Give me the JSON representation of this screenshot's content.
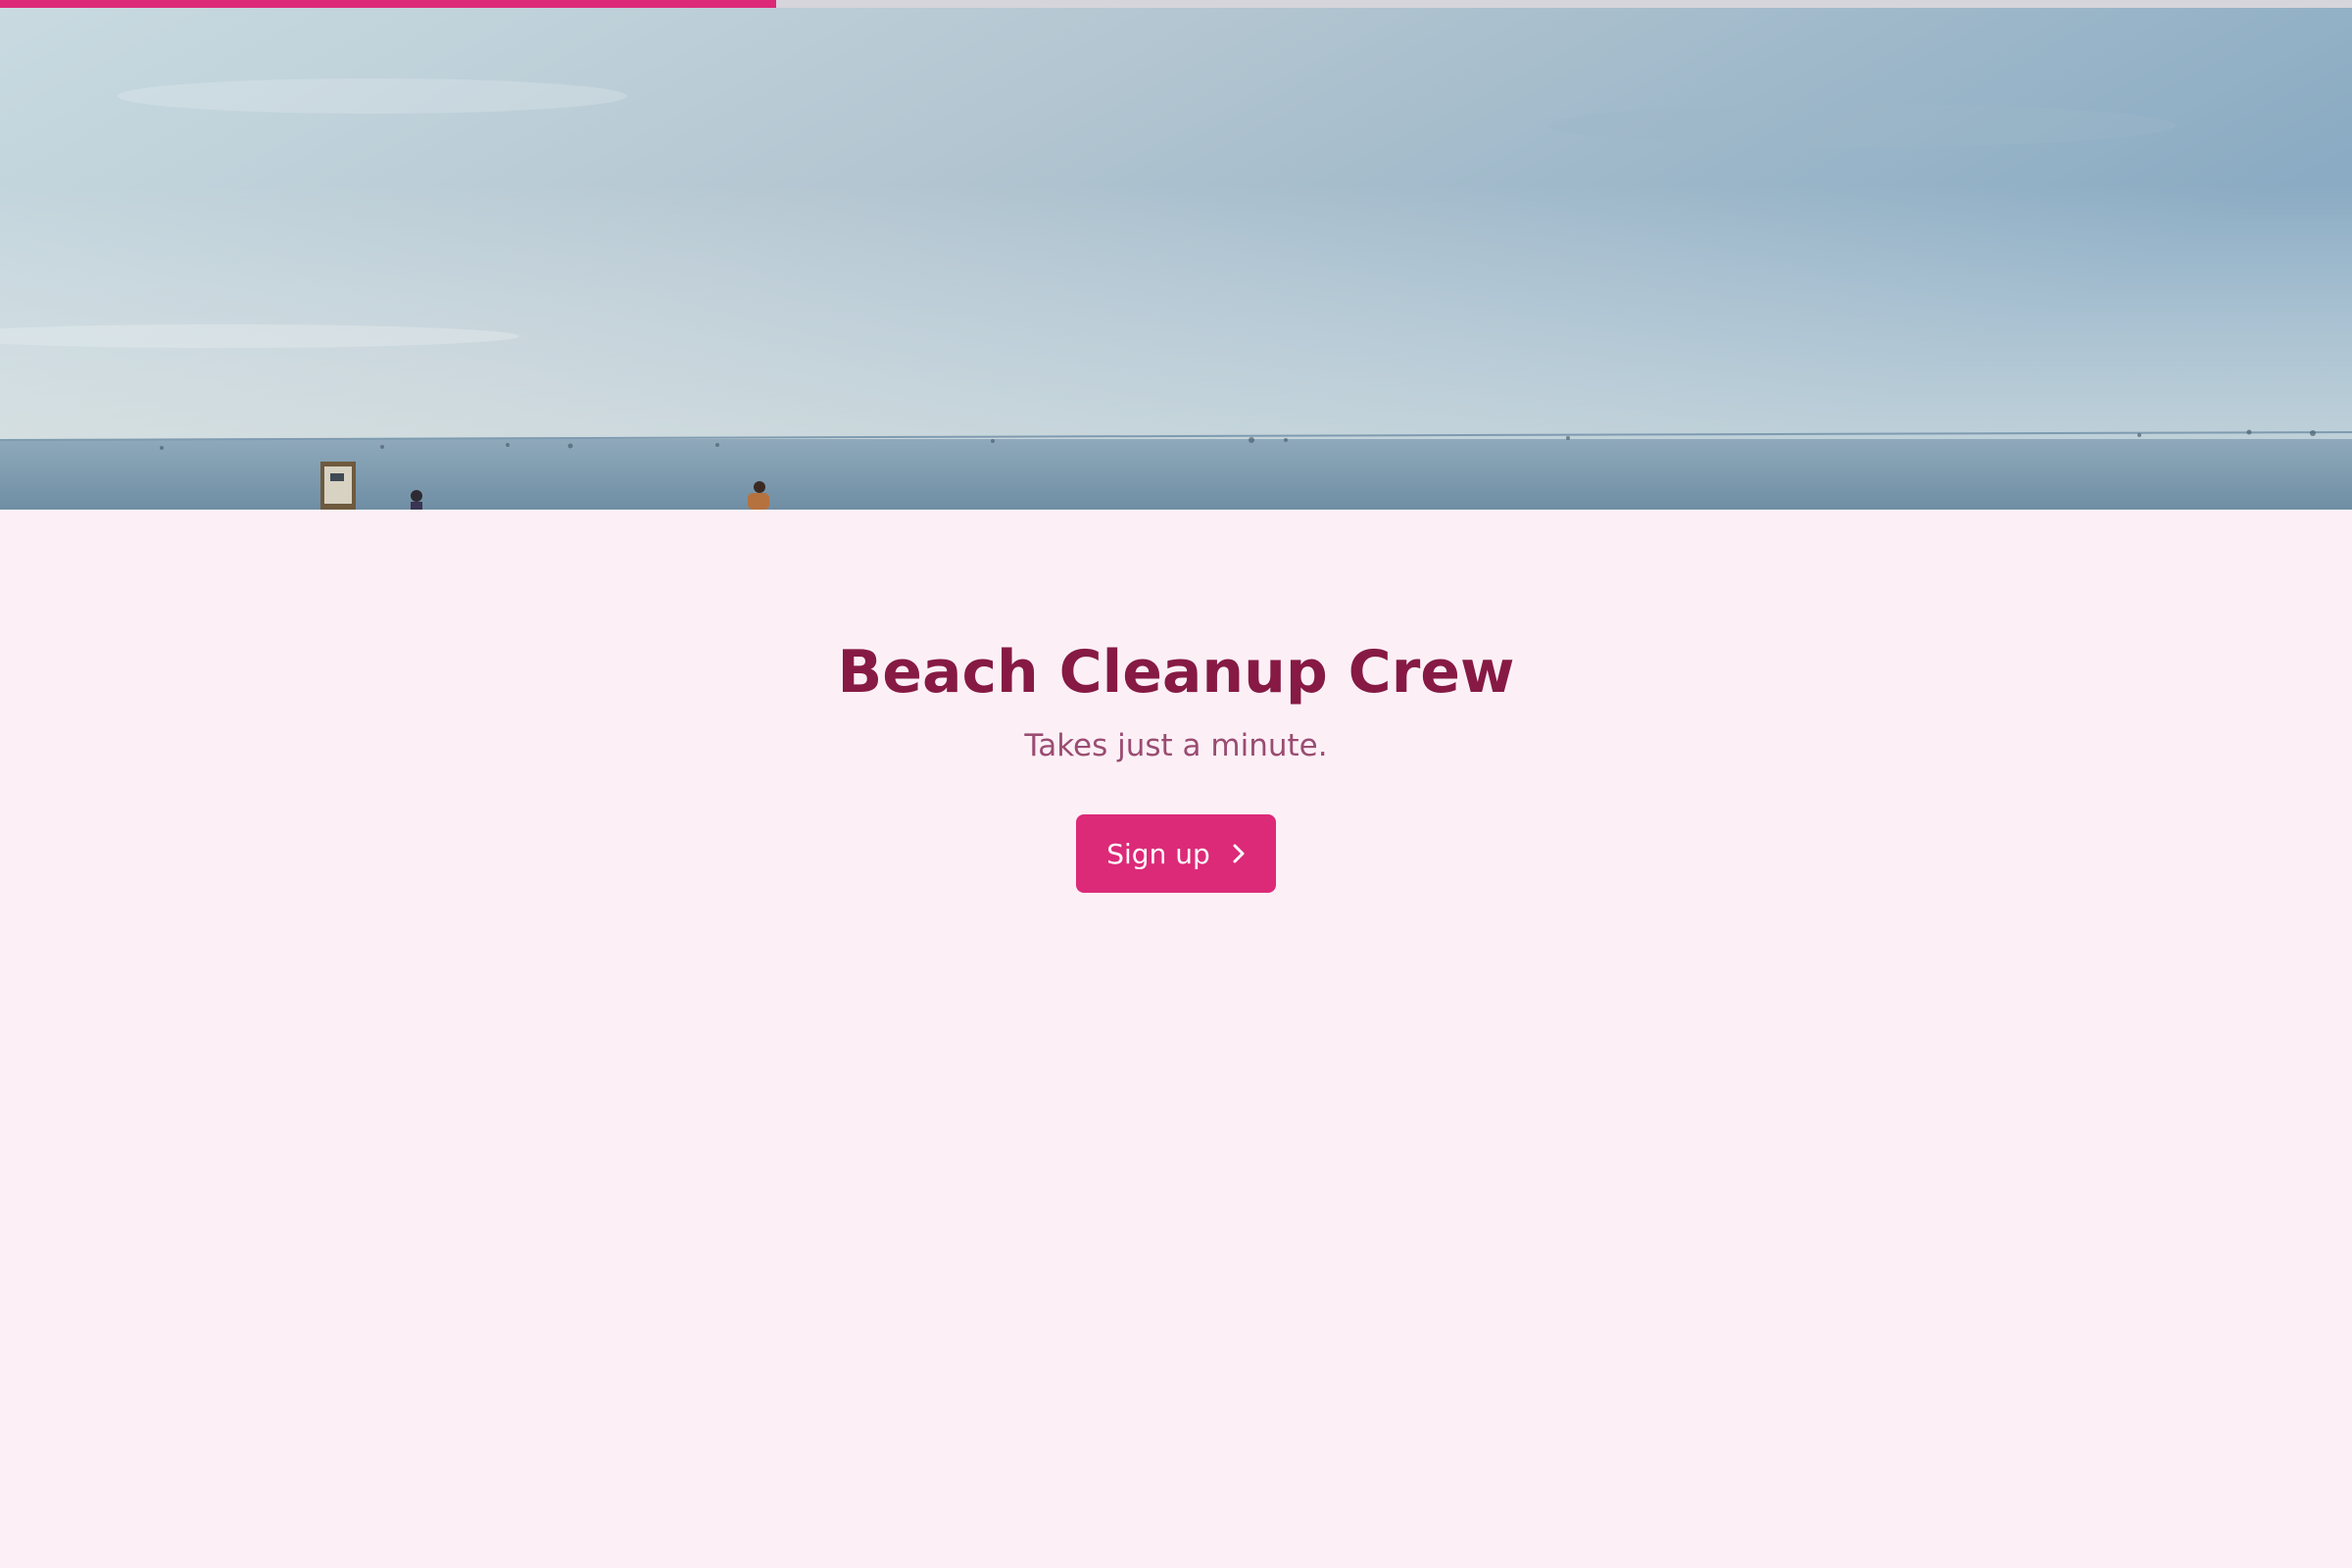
{
  "progress": {
    "fraction": 0.33,
    "color": "#dc2a78",
    "track_color": "#d6d5dc"
  },
  "hero": {
    "image": "beach-horizon-photo"
  },
  "main": {
    "title": "Beach Cleanup Crew",
    "subtitle": "Takes just a minute.",
    "signup_label": "Sign up",
    "signup_icon": "chevron-right-icon"
  },
  "colors": {
    "background": "#fcf0f6",
    "title": "#861a44",
    "subtitle": "#9a4c72",
    "accent": "#dc2a78"
  }
}
